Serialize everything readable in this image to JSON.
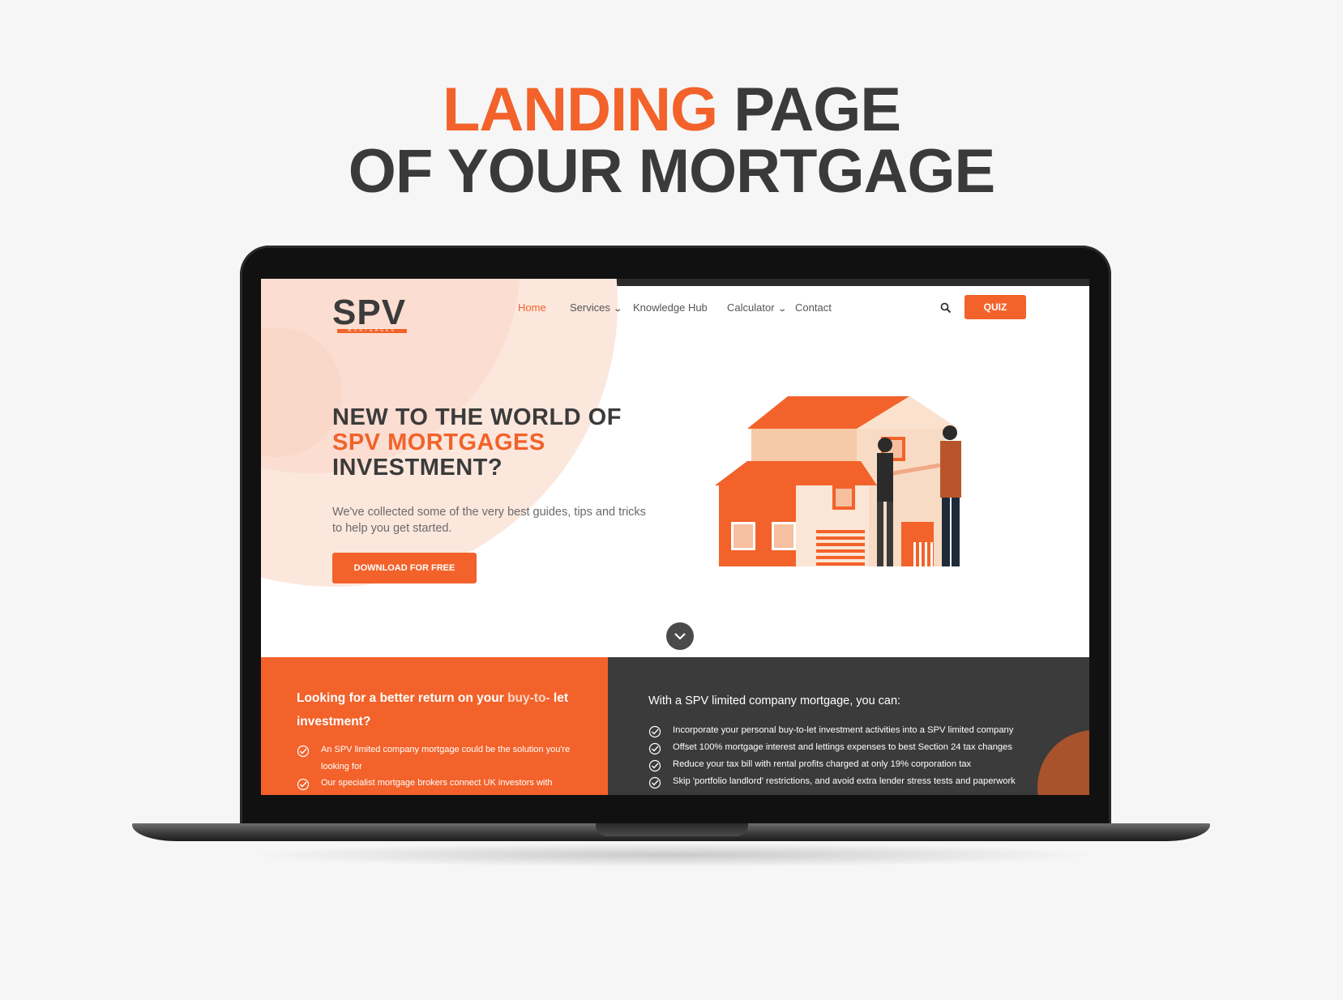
{
  "headline": {
    "line1_accent": "LANDING",
    "line1_rest": "PAGE",
    "line2": "OF YOUR MORTGAGE"
  },
  "colors": {
    "accent": "#f2622a",
    "dark": "#3b3b3b"
  },
  "site": {
    "logo": {
      "text": "SPV",
      "sub": "MORTGAGES"
    },
    "nav": {
      "home": "Home",
      "services": "Services",
      "knowledge_hub": "Knowledge Hub",
      "calculator": "Calculator",
      "contact": "Contact"
    },
    "quiz_label": "QUIZ",
    "hero": {
      "line1": "NEW TO THE WORLD OF",
      "line2": "SPV MORTGAGES",
      "line3": "INVESTMENT?",
      "subtitle": "We've collected some of the very best guides, tips and tricks to help you get started.",
      "cta": "DOWNLOAD FOR FREE"
    },
    "left_panel": {
      "title_main": "Looking for a better return on your ",
      "title_soft": "buy-to-",
      "title_end": "let investment?",
      "items": [
        "An SPV limited company mortgage could be the solution you're looking for",
        "Our specialist mortgage brokers connect UK investors with"
      ]
    },
    "right_panel": {
      "title": "With a SPV limited company mortgage, you can:",
      "items": [
        "Incorporate your personal buy-to-let investment activities into a SPV limited company",
        "Offset 100% mortgage interest and lettings expenses to best Section 24 tax changes",
        "Reduce your tax bill with rental profits charged at only 19% corporation tax",
        "Skip 'portfolio landlord' restrictions, and avoid extra lender stress tests and paperwork"
      ]
    }
  }
}
